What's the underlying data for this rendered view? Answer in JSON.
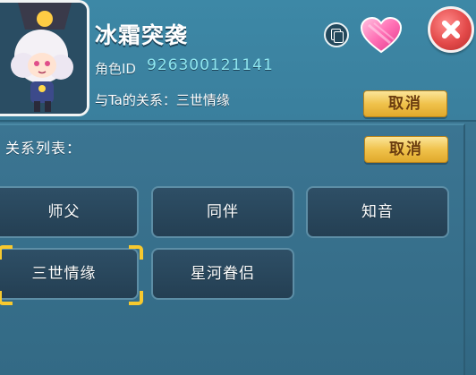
{
  "player": {
    "name": "冰霜突袭",
    "role_id_label": "角色ID",
    "role_id": "926300121141",
    "relation_line": "与Ta的关系：三世情缘"
  },
  "header": {
    "cancel_label": "取消"
  },
  "relation_list": {
    "title": "关系列表：",
    "cancel_label": "取消",
    "items": [
      {
        "label": "师父",
        "selected": false
      },
      {
        "label": "同伴",
        "selected": false
      },
      {
        "label": "知音",
        "selected": false
      },
      {
        "label": "三世情缘",
        "selected": true
      },
      {
        "label": "星河眷侣",
        "selected": false
      }
    ]
  },
  "icons": {
    "copy": "copy-icon",
    "heart": "heart-icon",
    "close": "close-icon"
  },
  "colors": {
    "panel_bg": "#3a7390",
    "gold_button": "#f0c24c",
    "close_red": "#e34a4a",
    "id_cyan": "#8fe6ef",
    "selection_gold": "#f7c92e"
  }
}
